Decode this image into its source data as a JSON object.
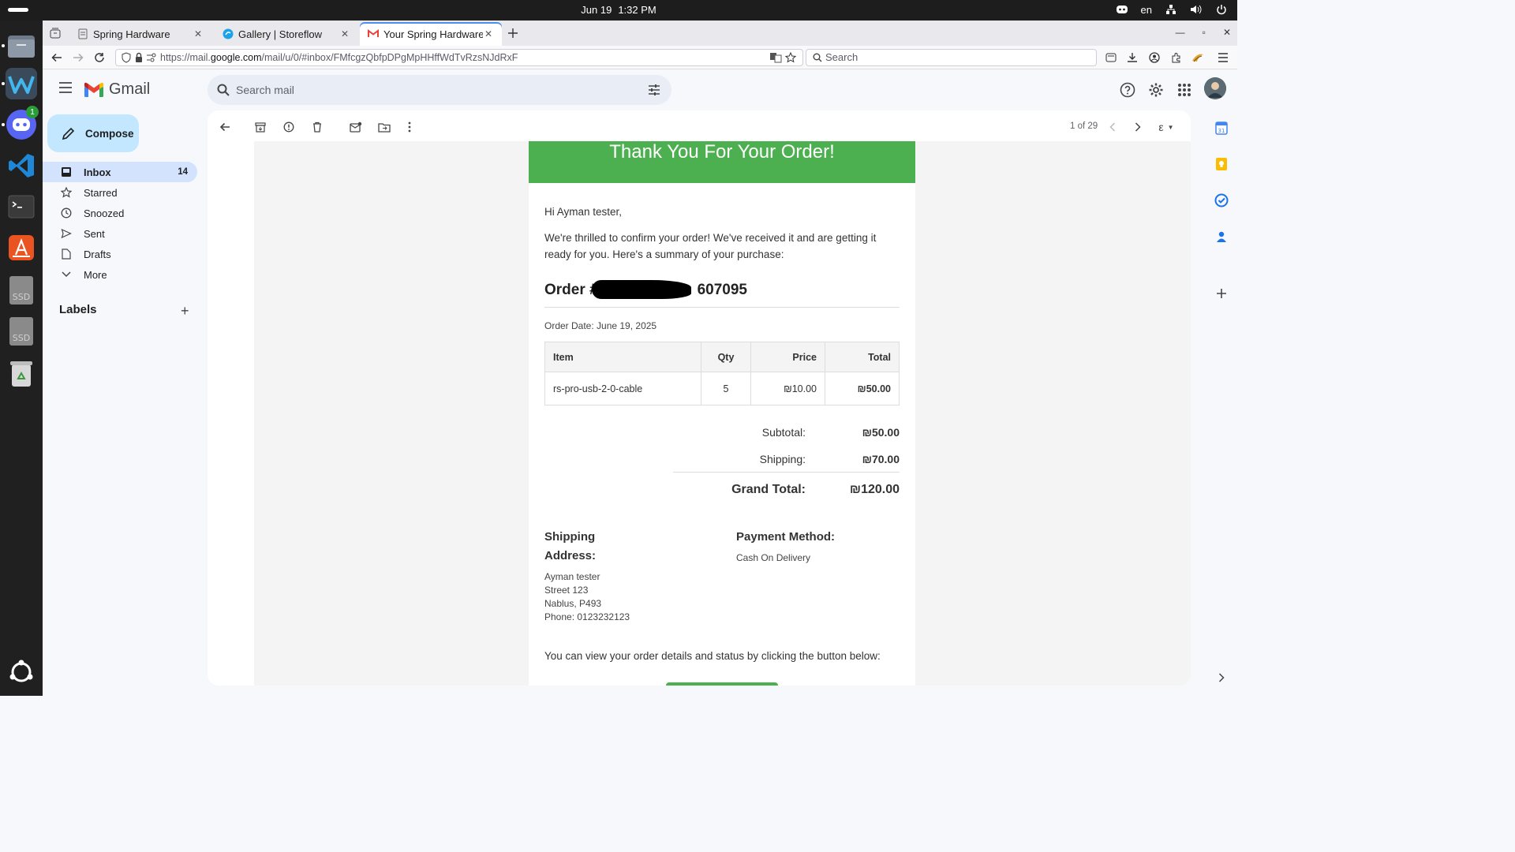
{
  "system": {
    "date": "Jun 19",
    "time": "1:32 PM",
    "lang": "en"
  },
  "dock": {
    "discord_badge": "1",
    "drive_label_1": "SSD",
    "drive_label_2": "SSD"
  },
  "tabs": [
    {
      "title": "Spring Hardware"
    },
    {
      "title": "Gallery | Storeflow"
    },
    {
      "title": "Your Spring Hardware Or"
    }
  ],
  "address": {
    "prefix": "https://mail.",
    "domain": "google.com",
    "suffix": "/mail/u/0/#inbox/FMfcgzQbfpDPgMpHHffWdTvRzsNJdRxF"
  },
  "search": {
    "placeholder": "Search"
  },
  "gmail": {
    "brand": "Gmail",
    "search_placeholder": "Search mail",
    "compose": "Compose",
    "nav": [
      {
        "label": "Inbox",
        "count": "14"
      },
      {
        "label": "Starred"
      },
      {
        "label": "Snoozed"
      },
      {
        "label": "Sent"
      },
      {
        "label": "Drafts"
      },
      {
        "label": "More"
      }
    ],
    "labels_heading": "Labels",
    "pager": "1 of 29",
    "lang_indicator": "ε"
  },
  "email": {
    "banner": "Thank You For Your Order!",
    "greeting": "Hi Ayman tester,",
    "intro": "We're thrilled to confirm your order! We've received it and are getting it ready for you. Here's a summary of your purchase:",
    "order_prefix": "Order #",
    "order_suffix": "607095",
    "order_date": "Order Date: June 19, 2025",
    "table": {
      "headers": [
        "Item",
        "Qty",
        "Price",
        "Total"
      ],
      "rows": [
        {
          "item": "rs-pro-usb-2-0-cable",
          "qty": "5",
          "price": "₪10.00",
          "total": "₪50.00"
        }
      ]
    },
    "subtotal_label": "Subtotal:",
    "subtotal": "₪50.00",
    "shipping_label": "Shipping:",
    "shipping": "₪70.00",
    "grand_label": "Grand Total:",
    "grand": "₪120.00",
    "ship_heading_1": "Shipping",
    "ship_heading_2": "Address:",
    "address_lines": [
      "Ayman tester",
      "Street 123",
      "Nablus, P493",
      "Phone: 0123232123"
    ],
    "payment_heading": "Payment Method:",
    "payment": "Cash On Delivery",
    "footer_text": "You can view your order details and status by clicking the button below:"
  },
  "colors": {
    "banner_green": "#4caf50",
    "compose_blue": "#c2e7ff",
    "inbox_active": "#d3e3fd"
  }
}
